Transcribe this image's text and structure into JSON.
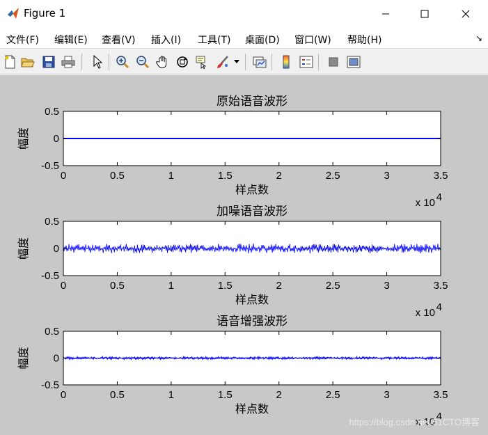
{
  "window": {
    "title": "Figure 1"
  },
  "menu": {
    "items": [
      "文件(F)",
      "编辑(E)",
      "查看(V)",
      "插入(I)",
      "工具(T)",
      "桌面(D)",
      "窗口(W)",
      "帮助(H)"
    ]
  },
  "toolbar": {
    "icons": [
      "new-figure-icon",
      "open-file-icon",
      "save-icon",
      "print-icon",
      "select-arrow-icon",
      "zoom-in-icon",
      "zoom-out-icon",
      "pan-hand-icon",
      "rotate-3d-icon",
      "data-cursor-icon",
      "brush-icon",
      "brush-dropdown-icon",
      "link-plot-icon",
      "colorbar-icon",
      "legend-icon",
      "hide-plot-tools-icon",
      "show-plot-tools-icon"
    ]
  },
  "colors": {
    "trace": "#0000ff",
    "canvas": "#c8c8c8",
    "axes_bg": "#ffffff"
  },
  "watermark": "https://blog.csdn.net/51CTO博客",
  "chart_data": [
    {
      "type": "line",
      "title": "原始语音波形",
      "xlabel": "样点数",
      "ylabel": "幅度",
      "xlim": [
        0,
        35000
      ],
      "ylim": [
        -0.5,
        0.5
      ],
      "x_ticks": [
        "0",
        "0.5",
        "1",
        "1.5",
        "2",
        "2.5",
        "3",
        "3.5"
      ],
      "y_ticks": [
        "0.5",
        "0",
        "-0.5"
      ],
      "x_exponent": "x 10",
      "x_exponent_power": "4",
      "amplitude": 0.004,
      "grid": false
    },
    {
      "type": "line",
      "title": "加噪语音波形",
      "xlabel": "样点数",
      "ylabel": "幅度",
      "xlim": [
        0,
        35000
      ],
      "ylim": [
        -0.5,
        0.5
      ],
      "x_ticks": [
        "0",
        "0.5",
        "1",
        "1.5",
        "2",
        "2.5",
        "3",
        "3.5"
      ],
      "y_ticks": [
        "0.5",
        "0",
        "-0.5"
      ],
      "x_exponent": "x 10",
      "x_exponent_power": "4",
      "amplitude": 0.1,
      "grid": false
    },
    {
      "type": "line",
      "title": "语音增强波形",
      "xlabel": "样点数",
      "ylabel": "幅度",
      "xlim": [
        0,
        35000
      ],
      "ylim": [
        -0.5,
        0.5
      ],
      "x_ticks": [
        "0",
        "0.5",
        "1",
        "1.5",
        "2",
        "2.5",
        "3",
        "3.5"
      ],
      "y_ticks": [
        "0.5",
        "0",
        "-0.5"
      ],
      "x_exponent": "x 10",
      "x_exponent_power": "4",
      "amplitude": 0.025,
      "grid": false
    }
  ]
}
